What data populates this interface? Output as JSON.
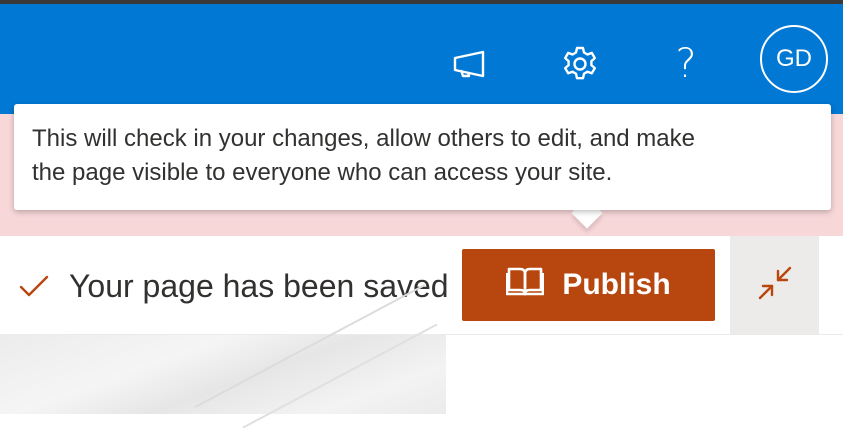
{
  "suite_bar": {
    "icons": [
      "megaphone-icon",
      "gear-icon",
      "help-icon"
    ],
    "help_glyph": "?",
    "avatar_initials": "GD",
    "background": "#0078d4"
  },
  "banner": {
    "background": "#f8d7d9"
  },
  "tooltip": {
    "line1": "This will check in your changes, allow others to edit, and make",
    "line2": "the page visible to everyone who can access your site."
  },
  "command_bar": {
    "status_icon": "checkmark-icon",
    "status_text": "Your page has been saved",
    "publish_icon": "book-icon",
    "publish_label": "Publish",
    "publish_color": "#b7470e",
    "collapse_icon": "collapse-arrows-icon"
  }
}
